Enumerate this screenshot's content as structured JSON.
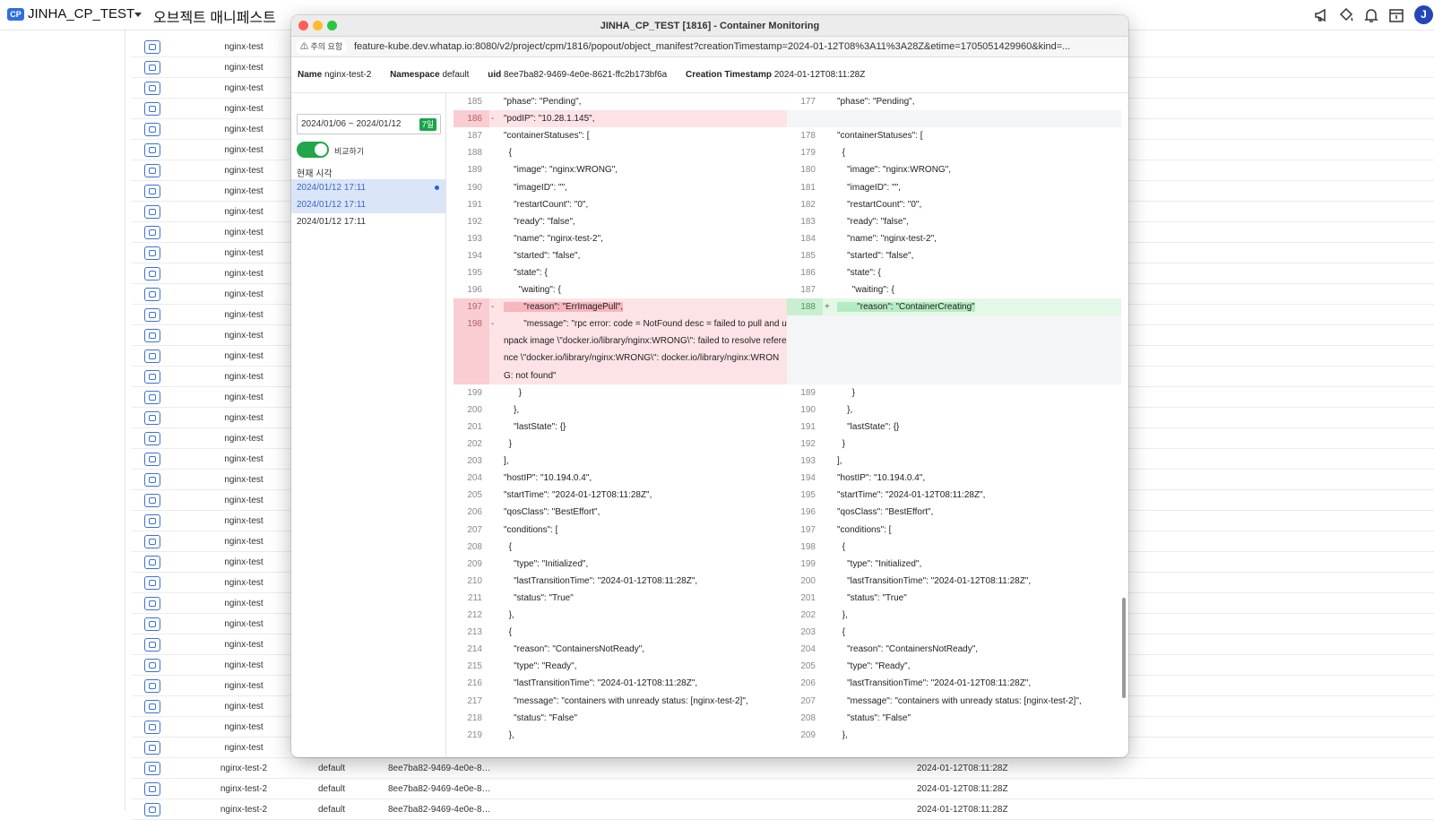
{
  "app": {
    "cp_badge": "CP",
    "project": "JINHA_CP_TEST",
    "page_title": "오브젝트 매니페스트",
    "avatar": "J",
    "icons": [
      "megaphone-icon",
      "paint-bucket-icon",
      "bell-icon",
      "calendar-icon"
    ]
  },
  "background_rows": [
    {
      "name": "nginx-test"
    },
    {
      "name": "nginx-test"
    },
    {
      "name": "nginx-test"
    },
    {
      "name": "nginx-test"
    },
    {
      "name": "nginx-test"
    },
    {
      "name": "nginx-test"
    },
    {
      "name": "nginx-test"
    },
    {
      "name": "nginx-test"
    },
    {
      "name": "nginx-test"
    },
    {
      "name": "nginx-test"
    },
    {
      "name": "nginx-test"
    },
    {
      "name": "nginx-test"
    },
    {
      "name": "nginx-test"
    },
    {
      "name": "nginx-test"
    },
    {
      "name": "nginx-test"
    },
    {
      "name": "nginx-test"
    },
    {
      "name": "nginx-test"
    },
    {
      "name": "nginx-test"
    },
    {
      "name": "nginx-test"
    },
    {
      "name": "nginx-test"
    },
    {
      "name": "nginx-test"
    },
    {
      "name": "nginx-test"
    },
    {
      "name": "nginx-test"
    },
    {
      "name": "nginx-test"
    },
    {
      "name": "nginx-test"
    },
    {
      "name": "nginx-test"
    },
    {
      "name": "nginx-test"
    },
    {
      "name": "nginx-test"
    },
    {
      "name": "nginx-test"
    },
    {
      "name": "nginx-test"
    },
    {
      "name": "nginx-test"
    },
    {
      "name": "nginx-test"
    },
    {
      "name": "nginx-test"
    },
    {
      "name": "nginx-test"
    },
    {
      "name": "nginx-test"
    },
    {
      "name": "nginx-test-2",
      "namespace": "default",
      "uid": "8ee7ba82-9469-4e0e-8…",
      "time": "2024-01-12T08:11:28Z"
    },
    {
      "name": "nginx-test-2",
      "namespace": "default",
      "uid": "8ee7ba82-9469-4e0e-8…",
      "time": "2024-01-12T08:11:28Z"
    },
    {
      "name": "nginx-test-2",
      "namespace": "default",
      "uid": "8ee7ba82-9469-4e0e-8…",
      "time": "2024-01-12T08:11:28Z"
    }
  ],
  "window": {
    "title": "JINHA_CP_TEST [1816] - Container Monitoring",
    "warning_label": "⚠ 주의 요함",
    "url": "feature-kube.dev.whatap.io:8080/v2/project/cpm/1816/popout/object_manifest?creationTimestamp=2024-01-12T08%3A11%3A28Z&etime=1705051429960&kind=...",
    "traffic_colors": {
      "close": "#ff5f57",
      "minimize": "#febc2e",
      "maximize": "#28c840"
    }
  },
  "meta": {
    "name_label": "Name",
    "name_value": "nginx-test-2",
    "ns_label": "Namespace",
    "ns_value": "default",
    "uid_label": "uid",
    "uid_value": "8ee7ba82-9469-4e0e-8621-ffc2b173bf6a",
    "ct_label": "Creation Timestamp",
    "ct_value": "2024-01-12T08:11:28Z"
  },
  "sidebar": {
    "date_range": "2024/01/06  ~  2024/01/12",
    "days_badge": "7일",
    "compare_label": "비교하기",
    "compare_on": true,
    "now_label": "현재 시각",
    "times": [
      {
        "label": "2024/01/12 17:11",
        "selected": true,
        "dot": true
      },
      {
        "label": "2024/01/12 17:11",
        "selected": true,
        "dot": false
      },
      {
        "label": "2024/01/12 17:11",
        "selected": false,
        "dot": false
      }
    ]
  },
  "diff_lines": [
    {
      "l": "185",
      "lt": "\"phase\": \"Pending\",",
      "r": "177",
      "rt": "\"phase\": \"Pending\","
    },
    {
      "l": "186",
      "lt": "\"podIP\": \"10.28.1.145\",",
      "r": "",
      "rt": "",
      "type": "del",
      "lm": "-"
    },
    {
      "l": "187",
      "lt": "\"containerStatuses\": [",
      "r": "178",
      "rt": "\"containerStatuses\": ["
    },
    {
      "l": "188",
      "lt": "  {",
      "r": "179",
      "rt": "  {"
    },
    {
      "l": "189",
      "lt": "    \"image\": \"nginx:WRONG\",",
      "r": "180",
      "rt": "    \"image\": \"nginx:WRONG\","
    },
    {
      "l": "190",
      "lt": "    \"imageID\": \"\",",
      "r": "181",
      "rt": "    \"imageID\": \"\","
    },
    {
      "l": "191",
      "lt": "    \"restartCount\": \"0\",",
      "r": "182",
      "rt": "    \"restartCount\": \"0\","
    },
    {
      "l": "192",
      "lt": "    \"ready\": \"false\",",
      "r": "183",
      "rt": "    \"ready\": \"false\","
    },
    {
      "l": "193",
      "lt": "    \"name\": \"nginx-test-2\",",
      "r": "184",
      "rt": "    \"name\": \"nginx-test-2\","
    },
    {
      "l": "194",
      "lt": "    \"started\": \"false\",",
      "r": "185",
      "rt": "    \"started\": \"false\","
    },
    {
      "l": "195",
      "lt": "    \"state\": {",
      "r": "186",
      "rt": "    \"state\": {"
    },
    {
      "l": "196",
      "lt": "      \"waiting\": {",
      "r": "187",
      "rt": "      \"waiting\": {"
    },
    {
      "l": "197",
      "lt": "        \"reason\": \"ErrImagePull\",",
      "r": "188",
      "rt": "        \"reason\": \"ContainerCreating\"",
      "type": "change",
      "lm": "-",
      "rm": "+"
    },
    {
      "l": "198",
      "lt": "        \"message\": \"rpc error: code = NotFound desc = failed to pull and unpack image \\\"docker.io/library/nginx:WRONG\\\": failed to resolve reference \\\"docker.io/library/nginx:WRONG\\\": docker.io/library/nginx:WRONG: not found\"",
      "r": "",
      "rt": "",
      "type": "del",
      "lm": "-",
      "h": 4
    },
    {
      "l": "199",
      "lt": "      }",
      "r": "189",
      "rt": "      }"
    },
    {
      "l": "200",
      "lt": "    },",
      "r": "190",
      "rt": "    },"
    },
    {
      "l": "201",
      "lt": "    \"lastState\": {}",
      "r": "191",
      "rt": "    \"lastState\": {}"
    },
    {
      "l": "202",
      "lt": "  }",
      "r": "192",
      "rt": "  }"
    },
    {
      "l": "203",
      "lt": "],",
      "r": "193",
      "rt": "],"
    },
    {
      "l": "204",
      "lt": "\"hostIP\": \"10.194.0.4\",",
      "r": "194",
      "rt": "\"hostIP\": \"10.194.0.4\","
    },
    {
      "l": "205",
      "lt": "\"startTime\": \"2024-01-12T08:11:28Z\",",
      "r": "195",
      "rt": "\"startTime\": \"2024-01-12T08:11:28Z\","
    },
    {
      "l": "206",
      "lt": "\"qosClass\": \"BestEffort\",",
      "r": "196",
      "rt": "\"qosClass\": \"BestEffort\","
    },
    {
      "l": "207",
      "lt": "\"conditions\": [",
      "r": "197",
      "rt": "\"conditions\": ["
    },
    {
      "l": "208",
      "lt": "  {",
      "r": "198",
      "rt": "  {"
    },
    {
      "l": "209",
      "lt": "    \"type\": \"Initialized\",",
      "r": "199",
      "rt": "    \"type\": \"Initialized\","
    },
    {
      "l": "210",
      "lt": "    \"lastTransitionTime\": \"2024-01-12T08:11:28Z\",",
      "r": "200",
      "rt": "    \"lastTransitionTime\": \"2024-01-12T08:11:28Z\","
    },
    {
      "l": "211",
      "lt": "    \"status\": \"True\"",
      "r": "201",
      "rt": "    \"status\": \"True\""
    },
    {
      "l": "212",
      "lt": "  },",
      "r": "202",
      "rt": "  },"
    },
    {
      "l": "213",
      "lt": "  {",
      "r": "203",
      "rt": "  {"
    },
    {
      "l": "214",
      "lt": "    \"reason\": \"ContainersNotReady\",",
      "r": "204",
      "rt": "    \"reason\": \"ContainersNotReady\","
    },
    {
      "l": "215",
      "lt": "    \"type\": \"Ready\",",
      "r": "205",
      "rt": "    \"type\": \"Ready\","
    },
    {
      "l": "216",
      "lt": "    \"lastTransitionTime\": \"2024-01-12T08:11:28Z\",",
      "r": "206",
      "rt": "    \"lastTransitionTime\": \"2024-01-12T08:11:28Z\","
    },
    {
      "l": "217",
      "lt": "    \"message\": \"containers with unready status: [nginx-test-2]\",",
      "r": "207",
      "rt": "    \"message\": \"containers with unready status: [nginx-test-2]\","
    },
    {
      "l": "218",
      "lt": "    \"status\": \"False\"",
      "r": "208",
      "rt": "    \"status\": \"False\""
    },
    {
      "l": "219",
      "lt": "  },",
      "r": "209",
      "rt": "  },"
    }
  ]
}
